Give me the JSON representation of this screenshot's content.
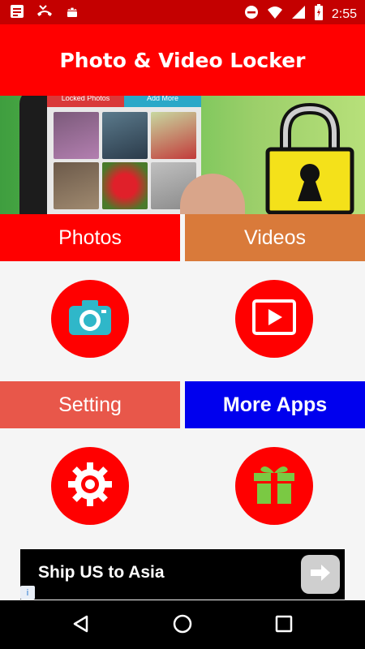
{
  "status_bar": {
    "time": "2:55",
    "icons": [
      "notification-icon",
      "missed-call-icon",
      "android-icon",
      "do-not-disturb-icon",
      "wifi-icon",
      "signal-icon",
      "battery-icon"
    ]
  },
  "app_bar": {
    "title": "Photo & Video Locker"
  },
  "banner": {
    "tabs": [
      "Locked Photos",
      "Add More"
    ]
  },
  "tiles": {
    "photos": "Photos",
    "videos": "Videos",
    "setting": "Setting",
    "more_apps": "More Apps"
  },
  "colors": {
    "primary": "#ff0000",
    "videos_tile": "#d97a3a",
    "setting_tile": "#e8574a",
    "more_apps_tile": "#0000ee"
  },
  "ad": {
    "text": "Ship US to Asia",
    "info": "i"
  }
}
